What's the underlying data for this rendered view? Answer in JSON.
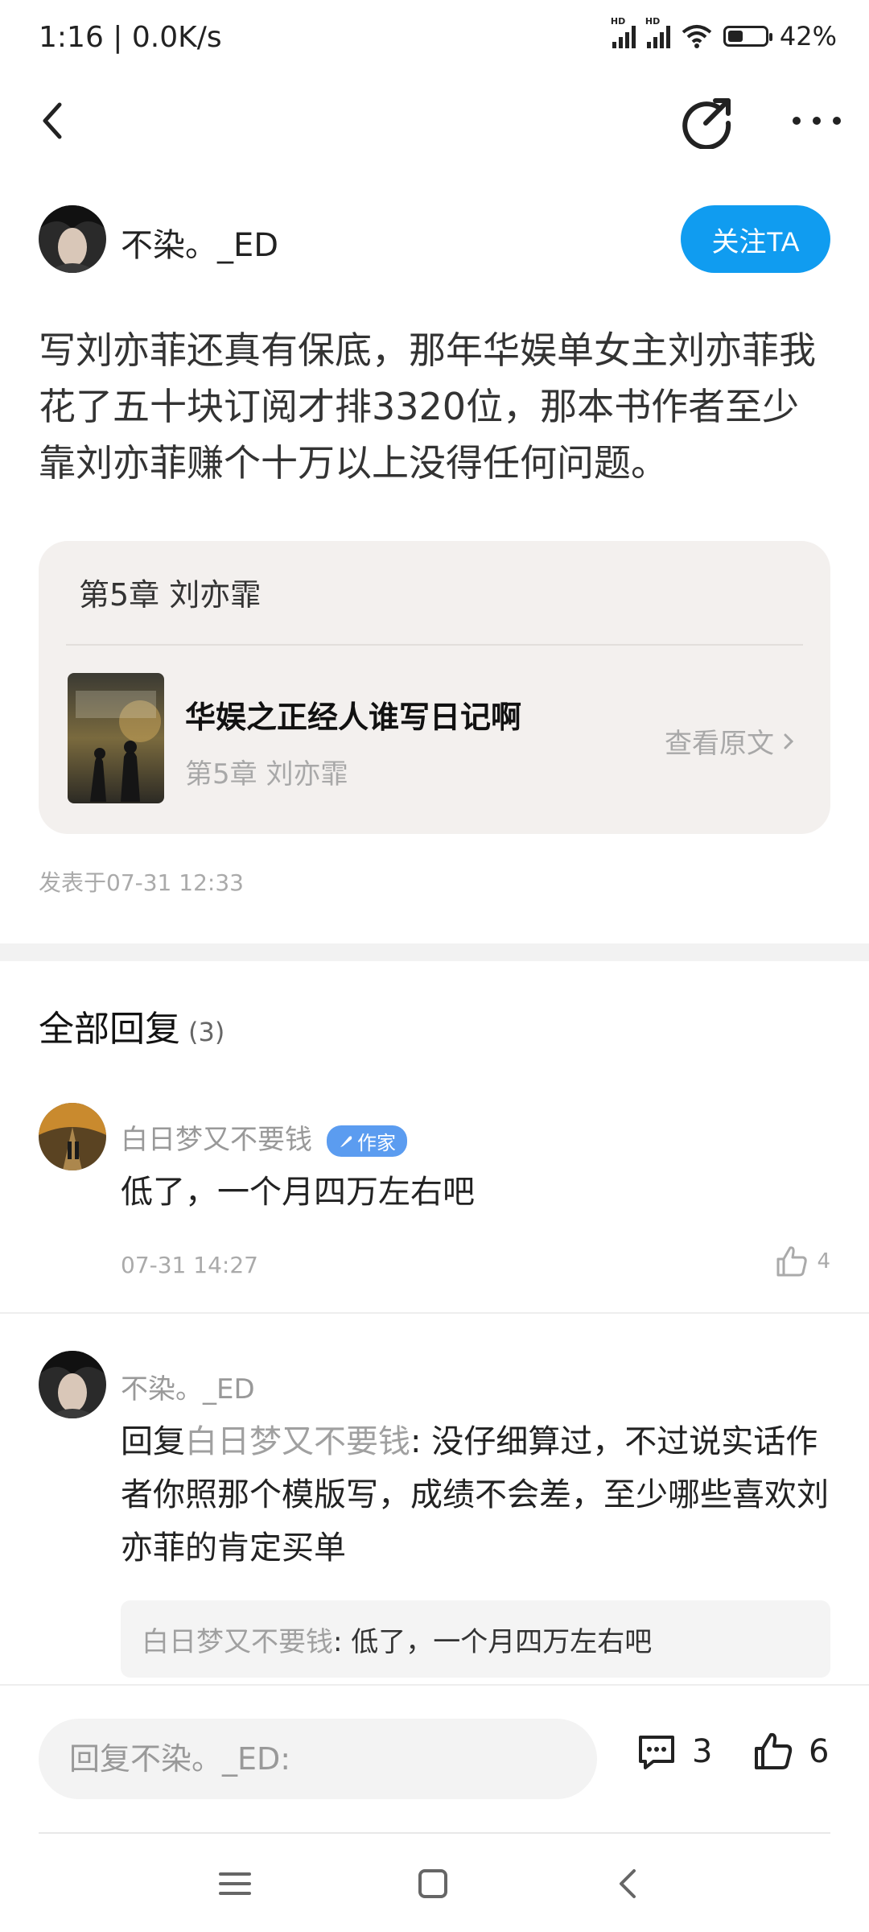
{
  "status": {
    "time": "1:16 | 0.0K/s",
    "battery": "42%",
    "battery_level": 0.42,
    "hd": "HD"
  },
  "author": {
    "name": "不染。_ED",
    "follow_label": "关注TA"
  },
  "post": {
    "text": "写刘亦菲还真有保底，那年华娱单女主刘亦菲我花了五十块订阅才排3320位，那本书作者至少靠刘亦菲赚个十万以上没得任何问题。",
    "posted": "发表于07-31 12:33"
  },
  "card": {
    "chapter": "第5章 刘亦霏",
    "book_title": "华娱之正经人谁写日记啊",
    "book_chapter": "第5章 刘亦霏",
    "view_label": "查看原文"
  },
  "replies": {
    "title": "全部回复",
    "count": "(3)",
    "items": [
      {
        "name": "白日梦又不要钱",
        "badge": "作家",
        "text": "低了，一个月四万左右吧",
        "time": "07-31 14:27",
        "likes": "4"
      },
      {
        "name": "不染。_ED",
        "reply_prefix": "回复",
        "reply_to": "白日梦又不要钱",
        "text": ": 没仔细算过，不过说实话作者你照那个模版写，成绩不会差，至少哪些喜欢刘亦菲的肯定买单",
        "quote_name": "白日梦又不要钱",
        "quote_text": ": 低了，一个月四万左右吧"
      }
    ]
  },
  "bottom": {
    "reply_placeholder": "回复不染。_ED:",
    "comment_count": "3",
    "like_count": "6"
  },
  "colors": {
    "accent": "#109cf0",
    "badge": "#5b9cf0"
  }
}
